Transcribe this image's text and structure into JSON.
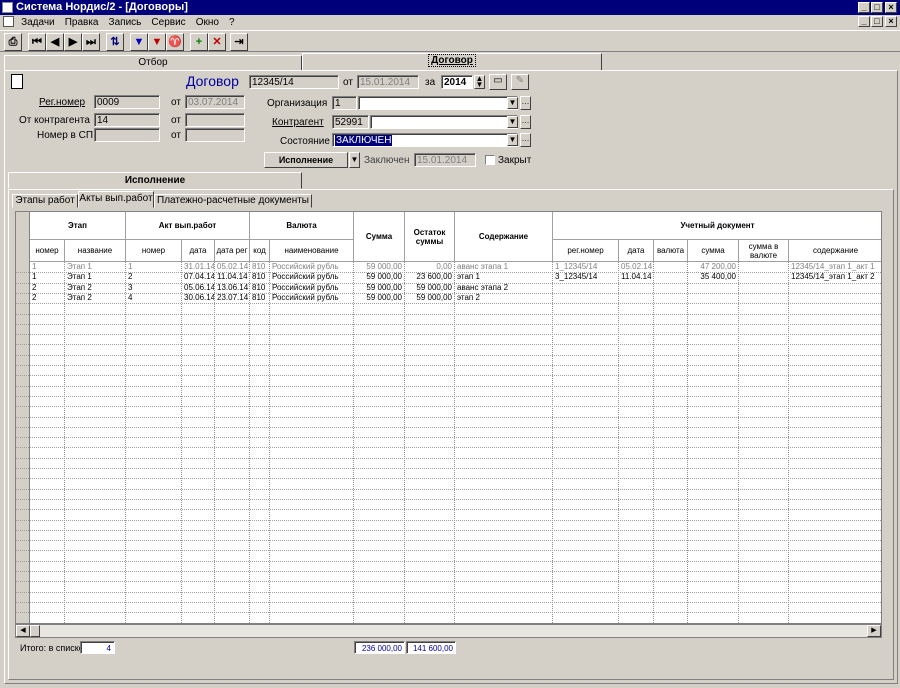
{
  "window": {
    "title": "Система Нордис/2 - [Договоры]"
  },
  "menu": [
    "Задачи",
    "Правка",
    "Запись",
    "Сервис",
    "Окно",
    "?"
  ],
  "toolbar": {
    "icons": [
      "print-icon",
      "first-record-icon",
      "prev-record-icon",
      "next-record-icon",
      "last-record-icon",
      "sort-icon",
      "save-icon",
      "delete-icon",
      "filter-icon",
      "add-icon",
      "close-icon",
      "exit-icon"
    ]
  },
  "tabs": {
    "filter": "Отбор",
    "contract": "Договор"
  },
  "contract": {
    "title": "Договор",
    "number": "12345/14",
    "from_label": "от",
    "date": "15.01.2014",
    "for_label": "за",
    "year": "2014",
    "reg_label": "Рег.номер",
    "reg_value": "0009",
    "reg_date_label": "от",
    "reg_date": "03.07.2014",
    "counterparty_label": "От контрагента",
    "counterparty_value": "14",
    "counterparty_date_label": "от",
    "counterparty_date": "",
    "sp_label": "Номер в СП",
    "sp_value": "",
    "sp_date_label": "от",
    "sp_date": "",
    "org_label": "Организация",
    "org_code": "1",
    "org_name": "",
    "kontr_label": "Контрагент",
    "kontr_code": "52991",
    "kontr_name": "",
    "state_label": "Состояние",
    "state_value": "ЗАКЛЮЧЕН",
    "exec_button": "Исполнение",
    "concluded_label": "Заключен",
    "concluded_date": "15.01.2014",
    "closed_label": "Закрыт"
  },
  "subtabs": {
    "main": "Исполнение",
    "items": [
      "Этапы работ",
      "Акты вып.работ",
      "Платежно-расчетные документы"
    ]
  },
  "table": {
    "group_headers": {
      "stage": "Этап",
      "act": "Акт вып.работ",
      "currency": "Валюта",
      "sum": "Сумма",
      "remain": "Остаток суммы",
      "content": "Содержание",
      "account_doc": "Учетный документ"
    },
    "sub_headers": {
      "stage_num": "номер",
      "stage_name": "название",
      "act_num": "номер",
      "act_date": "дата",
      "act_regdate": "дата рег",
      "cur_code": "код",
      "cur_name": "наименование",
      "doc_regnum": "рег.номер",
      "doc_date": "дата",
      "doc_currency": "валюта",
      "doc_sum": "сумма",
      "doc_sum_cur": "сумма в валюте",
      "doc_content": "содержание"
    },
    "rows": [
      {
        "stage_num": "1",
        "stage_name": "Этап 1",
        "act_num": "1",
        "act_date": "31.01.14",
        "act_regdate": "05.02.14",
        "cur_code": "810",
        "cur_name": "Российский рубль",
        "sum": "59 000,00",
        "remain": "0,00",
        "content": "аванс этапа 1",
        "doc_regnum": "1_12345/14",
        "doc_date": "05.02.14",
        "doc_currency": "",
        "doc_sum": "47 200,00",
        "doc_sum_cur": "",
        "doc_content": "12345/14_этап 1_акт 1",
        "muted": true
      },
      {
        "stage_num": "1",
        "stage_name": "Этап 1",
        "act_num": "2",
        "act_date": "07.04.14",
        "act_regdate": "11.04.14",
        "cur_code": "810",
        "cur_name": "Российский рубль",
        "sum": "59 000,00",
        "remain": "23 600,00",
        "content": "этап 1",
        "doc_regnum": "3_12345/14",
        "doc_date": "11.04.14",
        "doc_currency": "",
        "doc_sum": "35 400,00",
        "doc_sum_cur": "",
        "doc_content": "12345/14_этап 1_акт 2",
        "muted": false
      },
      {
        "stage_num": "2",
        "stage_name": "Этап 2",
        "act_num": "3",
        "act_date": "05.06.14",
        "act_regdate": "13.06.14",
        "cur_code": "810",
        "cur_name": "Российский рубль",
        "sum": "59 000,00",
        "remain": "59 000,00",
        "content": "аванс этапа 2",
        "doc_regnum": "",
        "doc_date": "",
        "doc_currency": "",
        "doc_sum": "",
        "doc_sum_cur": "",
        "doc_content": "",
        "muted": false
      },
      {
        "stage_num": "2",
        "stage_name": "Этап 2",
        "act_num": "4",
        "act_date": "30.06.14",
        "act_regdate": "23.07.14",
        "cur_code": "810",
        "cur_name": "Российский рубль",
        "sum": "59 000,00",
        "remain": "59 000,00",
        "content": "этап 2",
        "doc_regnum": "",
        "doc_date": "",
        "doc_currency": "",
        "doc_sum": "",
        "doc_sum_cur": "",
        "doc_content": "",
        "muted": false
      }
    ]
  },
  "footer": {
    "total_label": "Итого: в списке",
    "total_count": "4",
    "sum_total": "236 000,00",
    "remain_total": "141 600,00"
  }
}
